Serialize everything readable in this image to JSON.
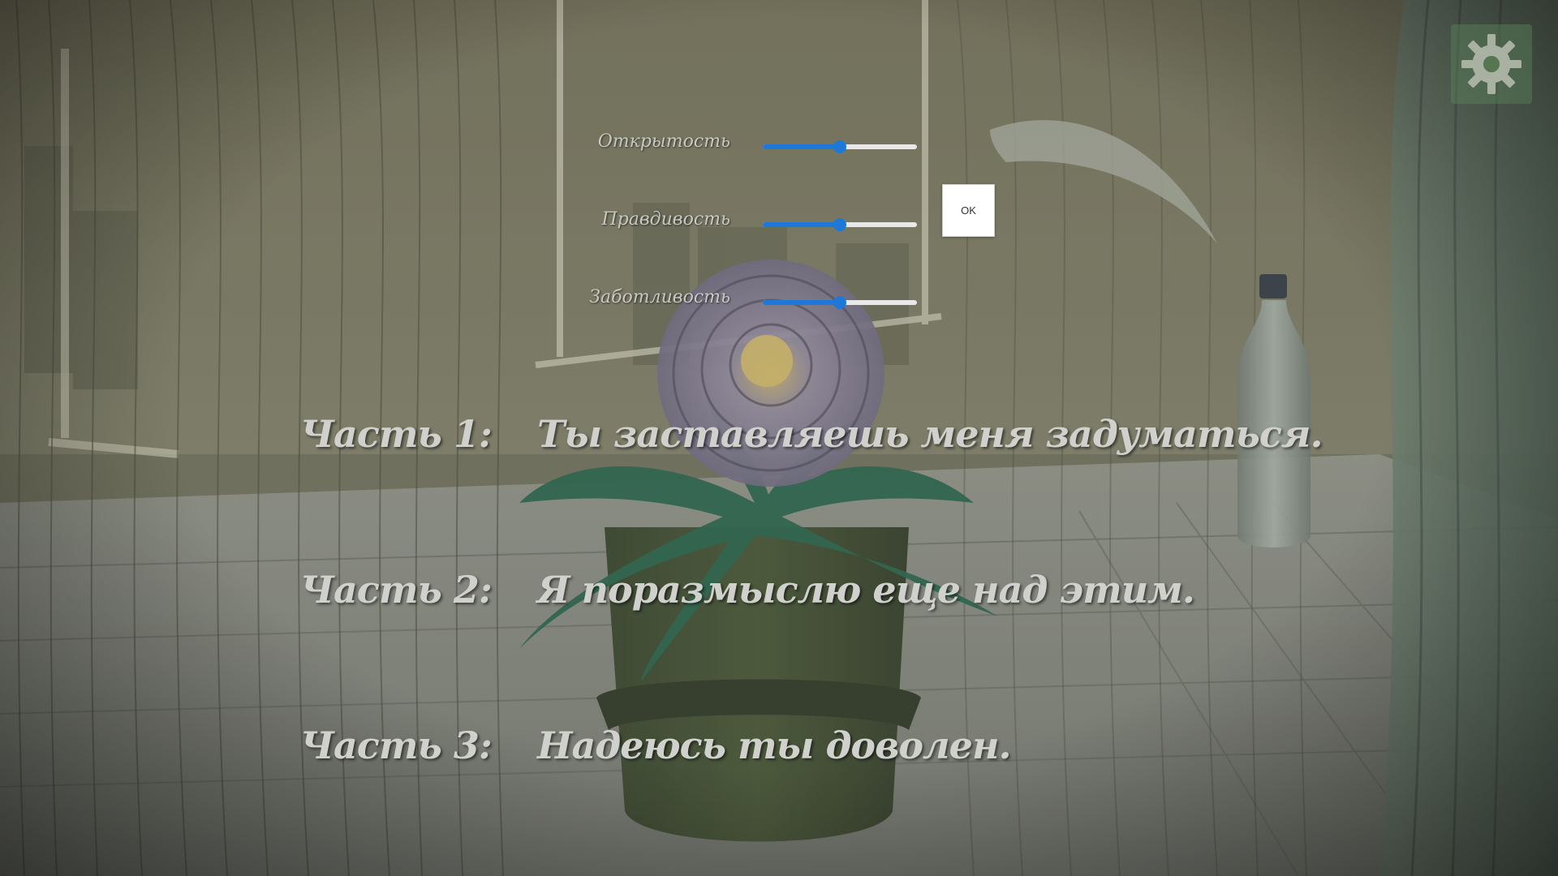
{
  "settings": {
    "icon": "gear-icon"
  },
  "sliders": [
    {
      "label": "Открытость",
      "value": 0.5
    },
    {
      "label": "Правдивость",
      "value": 0.5
    },
    {
      "label": "Заботливость",
      "value": 0.5
    }
  ],
  "ok_button": {
    "label": "OK"
  },
  "parts": [
    {
      "label": "Часть 1:",
      "text": "Ты заставляешь меня задуматься."
    },
    {
      "label": "Часть 2:",
      "text": "Я поразмыслю еще над этим."
    },
    {
      "label": "Часть 3:",
      "text": "Надеюсь ты доволен."
    }
  ],
  "colors": {
    "slider_accent": "#1e78d8",
    "dialogue_text": "#d0d0cc"
  }
}
